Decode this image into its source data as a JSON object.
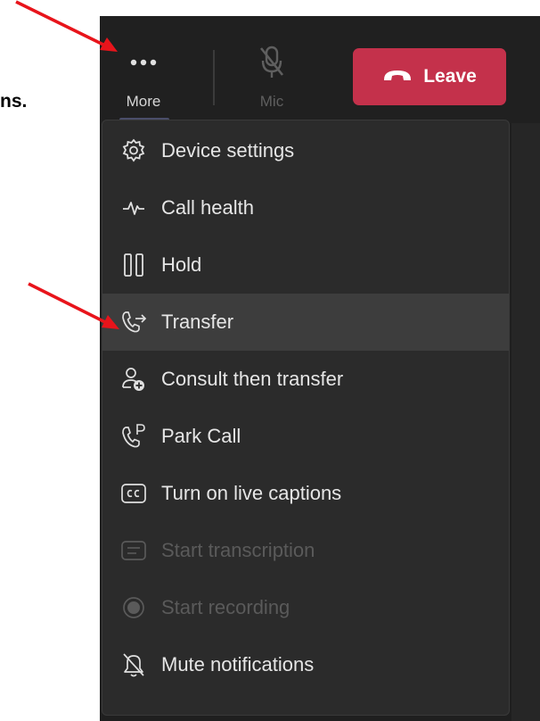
{
  "doc": {
    "clipped_text": "ns."
  },
  "toolbar": {
    "more_label": "More",
    "mic_label": "Mic",
    "leave_label": "Leave"
  },
  "menu": {
    "items": [
      {
        "label": "Device settings",
        "icon": "gear-icon",
        "state": "normal"
      },
      {
        "label": "Call health",
        "icon": "pulse-icon",
        "state": "normal"
      },
      {
        "label": "Hold",
        "icon": "pause-icon",
        "state": "normal"
      },
      {
        "label": "Transfer",
        "icon": "phone-transfer-icon",
        "state": "selected"
      },
      {
        "label": "Consult then transfer",
        "icon": "person-add-icon",
        "state": "normal"
      },
      {
        "label": "Park Call",
        "icon": "phone-park-icon",
        "state": "normal"
      },
      {
        "label": "Turn on live captions",
        "icon": "closed-captions-icon",
        "state": "normal"
      },
      {
        "label": "Start transcription",
        "icon": "transcript-icon",
        "state": "disabled"
      },
      {
        "label": "Start recording",
        "icon": "record-icon",
        "state": "disabled"
      },
      {
        "label": "Mute notifications",
        "icon": "bell-off-icon",
        "state": "normal"
      }
    ]
  },
  "colors": {
    "leave_red": "#c4314b",
    "app_background": "#1f1f1f",
    "menu_background": "#2b2b2b",
    "selected_row": "#3d3d3d",
    "annotation_arrow": "#e8141b"
  }
}
